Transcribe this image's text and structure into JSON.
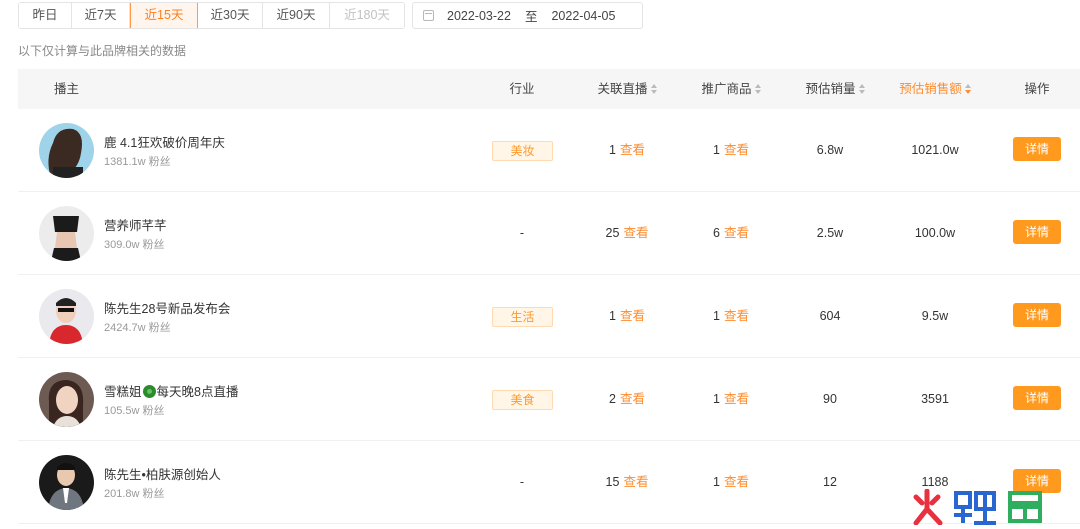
{
  "filters": {
    "ranges": [
      {
        "label": "昨日",
        "state": "normal"
      },
      {
        "label": "近7天",
        "state": "normal"
      },
      {
        "label": "近15天",
        "state": "active"
      },
      {
        "label": "近30天",
        "state": "normal"
      },
      {
        "label": "近90天",
        "state": "normal"
      },
      {
        "label": "近180天",
        "state": "disabled"
      }
    ],
    "date_start": "2022-03-22",
    "date_sep": "至",
    "date_end": "2022-04-05",
    "icon": "calendar-icon"
  },
  "note": "以下仅计算与此品牌相关的数据",
  "table": {
    "headers": {
      "streamer": "播主",
      "industry": "行业",
      "related_live": "关联直播",
      "promoted": "推广商品",
      "sales": "预估销量",
      "revenue": "预估销售额",
      "action": "操作"
    },
    "link_text": "查看",
    "detail_label": "详情",
    "rows": [
      {
        "name": "鹿 4.1狂欢破价周年庆",
        "fans": "1381.1w 粉丝",
        "industry": "美妆",
        "live_count": "1",
        "product_count": "1",
        "sales": "6.8w",
        "revenue": "1021.0w"
      },
      {
        "name": "营养师芊芊",
        "fans": "309.0w 粉丝",
        "industry": "-",
        "live_count": "25",
        "product_count": "6",
        "sales": "2.5w",
        "revenue": "100.0w"
      },
      {
        "name": "陈先生28号新品发布会",
        "fans": "2424.7w 粉丝",
        "industry": "生活",
        "live_count": "1",
        "product_count": "1",
        "sales": "604",
        "revenue": "9.5w"
      },
      {
        "name_a": "雪糕姐",
        "name_b": "每天晚8点直播",
        "fans": "105.5w 粉丝",
        "industry": "美食",
        "live_count": "2",
        "product_count": "1",
        "sales": "90",
        "revenue": "3591"
      },
      {
        "name": "陈先生•柏肤源创始人",
        "fans": "201.8w 粉丝",
        "industry": "-",
        "live_count": "15",
        "product_count": "1",
        "sales": "12",
        "revenue": "1188"
      }
    ]
  },
  "colors": {
    "accent": "#ff8c2e",
    "button": "#ff9a1f",
    "tag_bg": "#fff6e8",
    "header_bg": "#f6f6f6"
  }
}
